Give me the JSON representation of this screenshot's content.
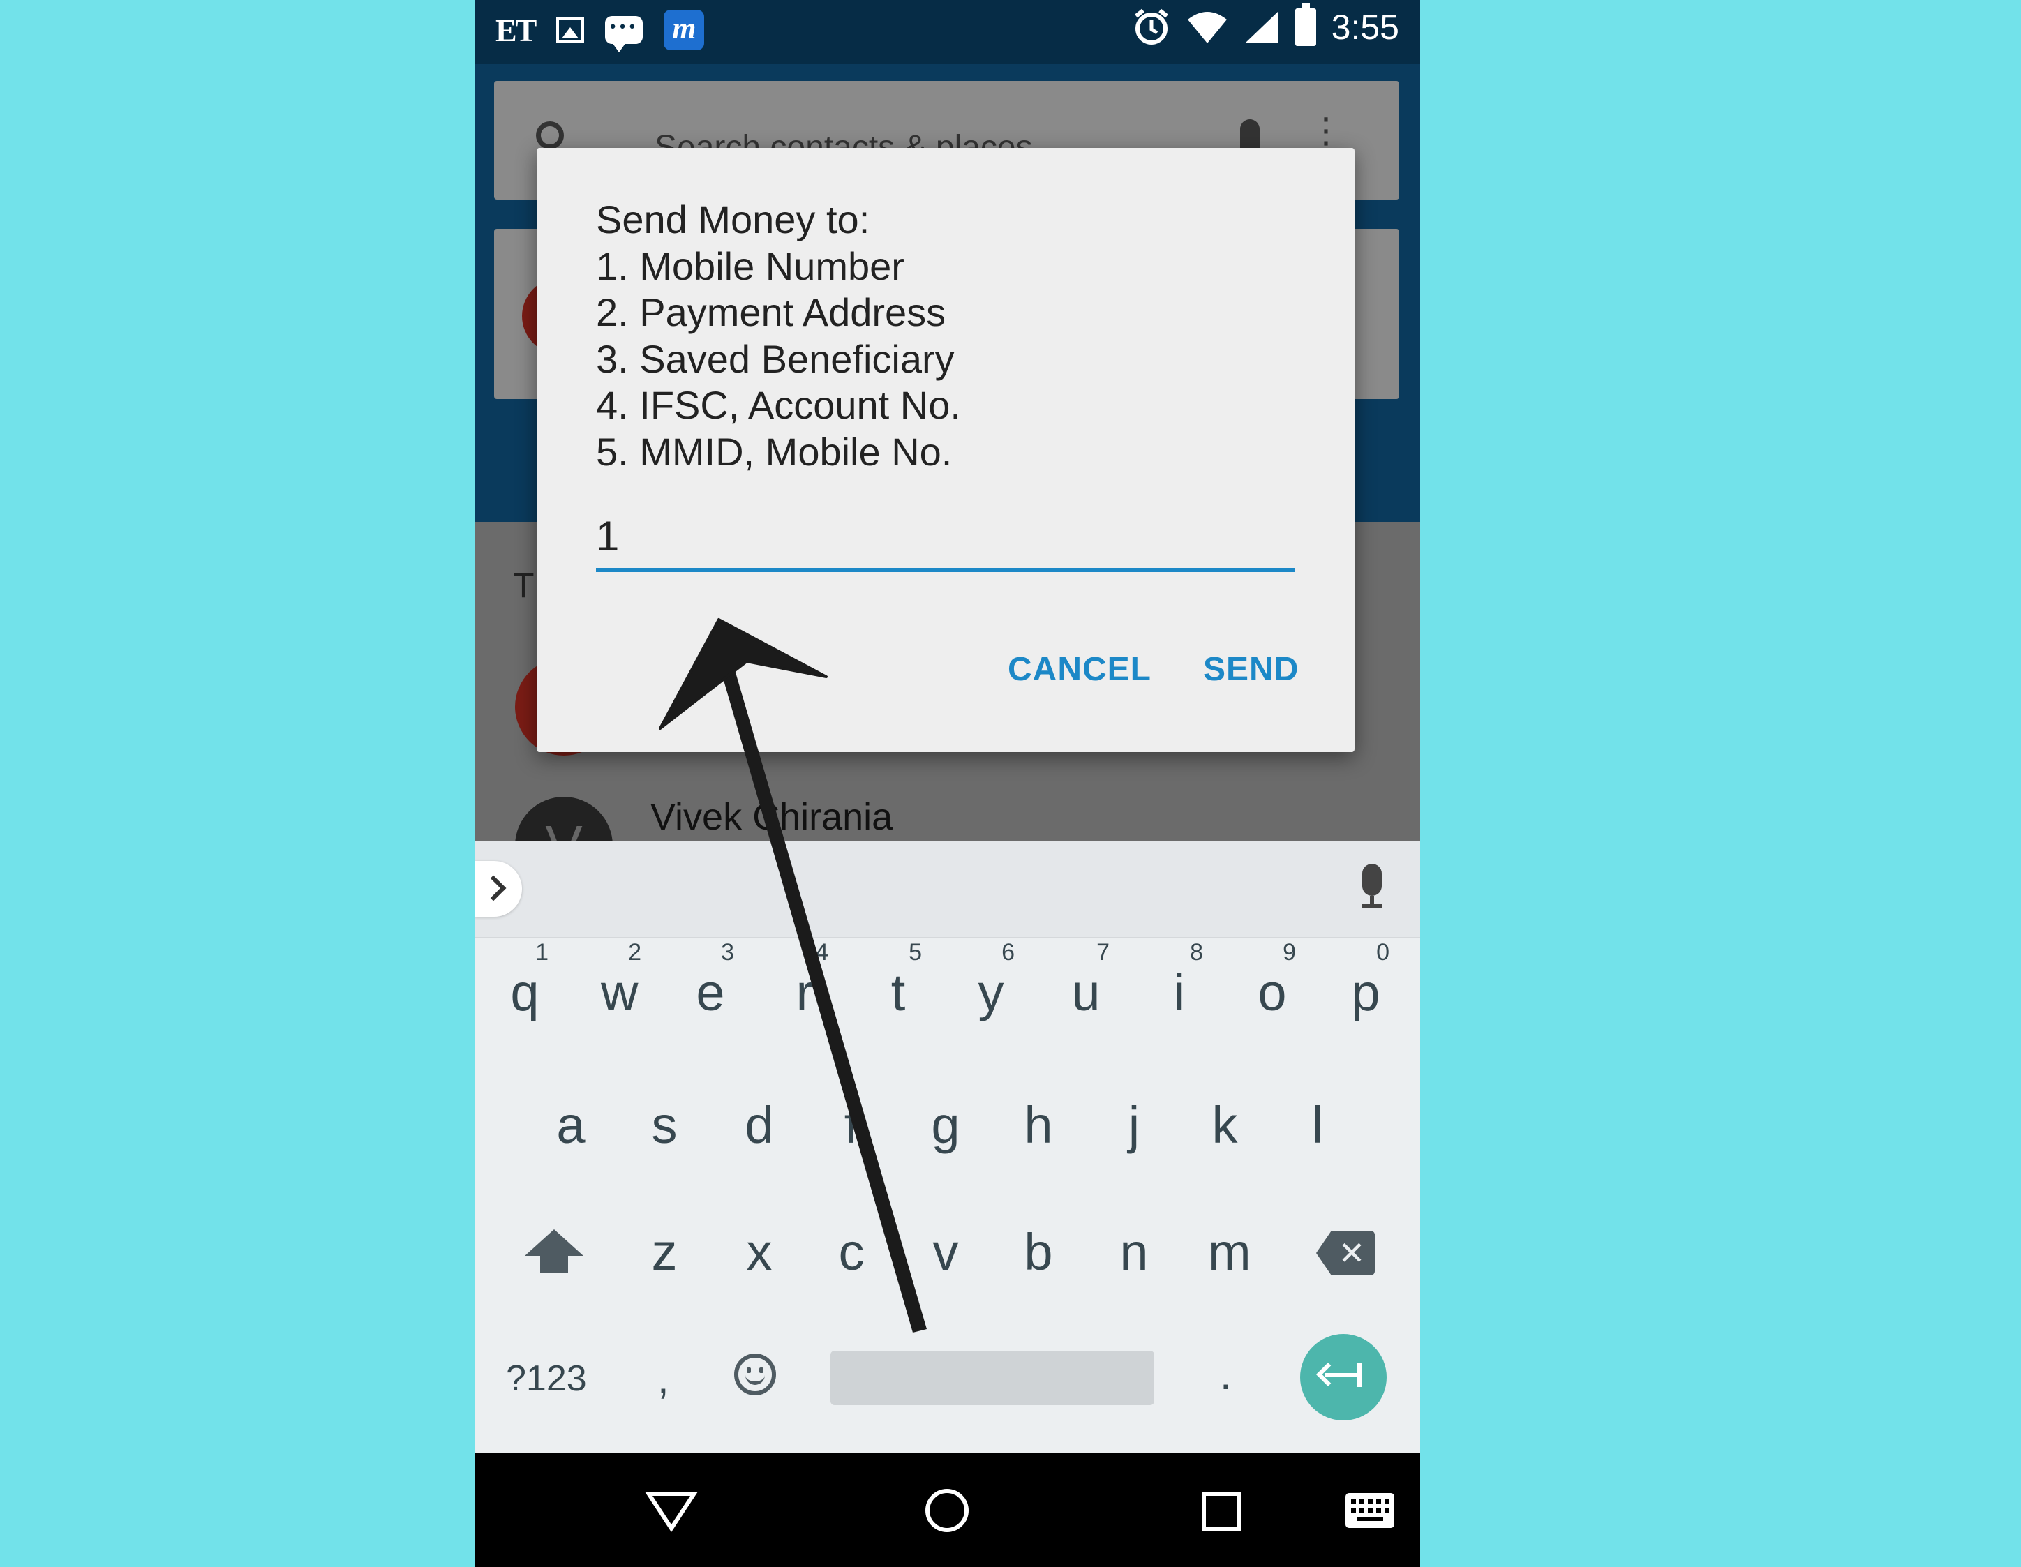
{
  "status_bar": {
    "left_icons": [
      "ET",
      "image-icon",
      "chat-icon",
      "m-app-icon"
    ],
    "et_label": "ET",
    "m_label": "m",
    "time": "3:55",
    "right_icons": [
      "alarm-icon",
      "wifi-icon",
      "signal-icon",
      "battery-icon"
    ]
  },
  "background_app": {
    "search_placeholder": "Search contacts & places",
    "list_heading_partial": "T",
    "contact_name": "Vivek Chirania",
    "contact_avatar_letter": "V"
  },
  "dialog": {
    "message_lines": [
      "Send Money to:",
      "1. Mobile Number",
      "2. Payment Address",
      "3. Saved Beneficiary",
      "4. IFSC, Account No.",
      "5. MMID, Mobile No."
    ],
    "input_value": "1",
    "cancel_label": "CANCEL",
    "send_label": "SEND",
    "accent_color": "#1c88c7"
  },
  "keyboard": {
    "row1": [
      {
        "key": "q",
        "hint": "1"
      },
      {
        "key": "w",
        "hint": "2"
      },
      {
        "key": "e",
        "hint": "3"
      },
      {
        "key": "r",
        "hint": "4"
      },
      {
        "key": "t",
        "hint": "5"
      },
      {
        "key": "y",
        "hint": "6"
      },
      {
        "key": "u",
        "hint": "7"
      },
      {
        "key": "i",
        "hint": "8"
      },
      {
        "key": "o",
        "hint": "9"
      },
      {
        "key": "p",
        "hint": "0"
      }
    ],
    "row2": [
      "a",
      "s",
      "d",
      "f",
      "g",
      "h",
      "j",
      "k",
      "l"
    ],
    "row3": [
      "z",
      "x",
      "c",
      "v",
      "b",
      "n",
      "m"
    ],
    "symbols_label": "?123",
    "comma_label": ",",
    "period_label": ".",
    "enter_color": "#4db6ac"
  },
  "nav_bar": {
    "icons": [
      "back-icon",
      "home-icon",
      "recents-icon",
      "keyboard-switch-icon"
    ]
  }
}
